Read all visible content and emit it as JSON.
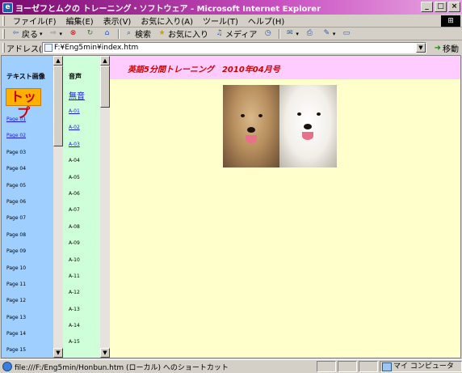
{
  "window": {
    "title": "ヨーゼフとムクの トレーニング・ソフトウェア - Microsoft Internet Explorer",
    "controls": [
      "_",
      "□",
      "×"
    ]
  },
  "menu": [
    "ファイル(F)",
    "編集(E)",
    "表示(V)",
    "お気に入り(A)",
    "ツール(T)",
    "ヘルプ(H)"
  ],
  "toolbar": {
    "back": "戻る",
    "search": "検索",
    "favorites": "お気に入り",
    "media": "メディア"
  },
  "address": {
    "label": "アドレス(D)",
    "url": "F:¥Eng5min¥index.htm",
    "go": "移動"
  },
  "left_frame": {
    "title": "テキスト画像",
    "top_button": "トップ",
    "pages": [
      "Page 01",
      "Page 02",
      "Page 03",
      "Page 04",
      "Page 05",
      "Page 06",
      "Page 07",
      "Page 08",
      "Page 09",
      "Page 10",
      "Page 11",
      "Page 12",
      "Page 13",
      "Page 14",
      "Page 15"
    ],
    "linked_count": 2
  },
  "mid_frame": {
    "title": "音声",
    "mute": "無音",
    "tracks": [
      "A-01",
      "A-02",
      "A-03",
      "A-04",
      "A-05",
      "A-06",
      "A-07",
      "A-08",
      "A-09",
      "A-10",
      "A-11",
      "A-12",
      "A-13",
      "A-14",
      "A-15"
    ],
    "linked_count": 3
  },
  "main_frame": {
    "header": "英語5分間トレーニング　2010年04月号"
  },
  "status": {
    "text": "file:///F:/Eng5min/Honbun.htm (ローカル) へのショートカット",
    "zone": "マイ コンピュータ"
  },
  "colors": {
    "title_gradient_start": "#7a0a6e",
    "left_frame_bg": "#9fcfff",
    "mid_frame_bg": "#cfffd8",
    "main_bg": "#ffffcc",
    "header_bg": "#ffccff",
    "header_text": "#cc0000",
    "top_button_bg": "#ffb000"
  }
}
